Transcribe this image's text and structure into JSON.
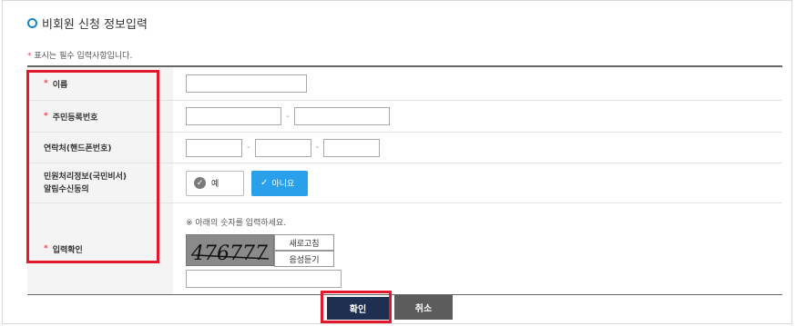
{
  "section_title": "비회원 신청 정보입력",
  "required_note": {
    "mark": "*",
    "text": "표시는 필수 입력사항입니다."
  },
  "rows": {
    "name": {
      "mark": "*",
      "label": "이름"
    },
    "rrn": {
      "mark": "*",
      "label": "주민등록번호"
    },
    "phone": {
      "label": "연락처(핸드폰번호)"
    },
    "consent": {
      "label_line1": "민원처리정보(국민비서)",
      "label_line2": "알림수신동의",
      "yes_label": "예",
      "no_label": "아니요",
      "selected": "아니요"
    },
    "captcha": {
      "mark": "*",
      "label": "입력확인",
      "hint": "※ 아래의 숫자를 입력하세요.",
      "image_text": "476777",
      "refresh_label": "새로고침",
      "audio_label": "음성듣기"
    }
  },
  "separator": "-",
  "buttons": {
    "confirm": "확인",
    "cancel": "취소"
  },
  "colors": {
    "accent_blue": "#2aa0ea",
    "required_red": "#e8465a",
    "highlight_red": "#e3182d",
    "confirm_navy": "#1f2f52",
    "cancel_gray": "#5c5c5c"
  }
}
